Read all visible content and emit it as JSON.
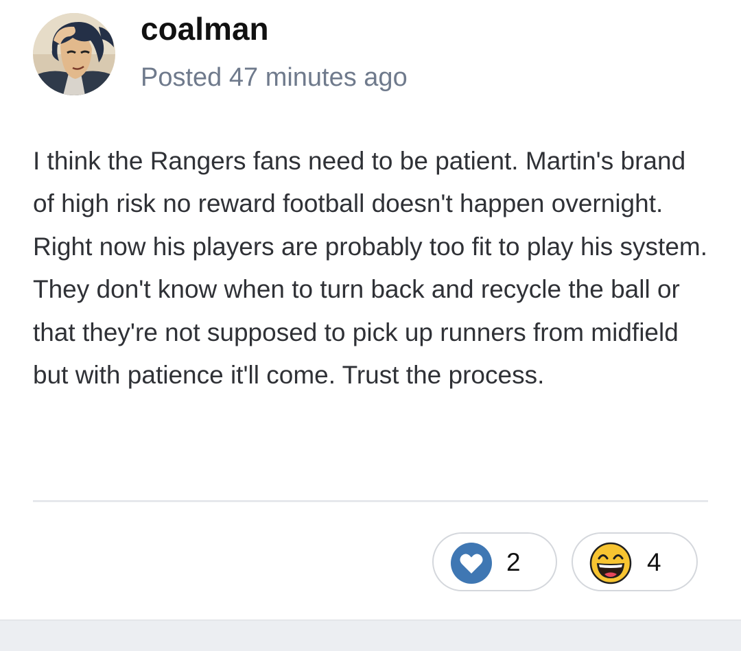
{
  "post": {
    "author": "coalman",
    "timestamp": "Posted 47 minutes ago",
    "avatar": "anime-character-avatar",
    "body": "I think the Rangers fans need to be patient. Martin's brand of high risk no reward football doesn't happen overnight. Right now his players are probably too fit to play his system. They don't know when to turn back and recycle the ball or that they're not supposed to pick up runners from midfield but with patience it'll come. Trust the process."
  },
  "reactions": [
    {
      "icon": "heart-icon",
      "count": "2",
      "color": "#3f77b3"
    },
    {
      "icon": "laughing-face-icon",
      "count": "4",
      "color": "#f7c431"
    }
  ],
  "colors": {
    "author": "#111111",
    "timestamp": "#6f7a8c",
    "body_text": "#2f3136",
    "divider": "#e6e8ec",
    "footer_band": "#eceef2"
  }
}
